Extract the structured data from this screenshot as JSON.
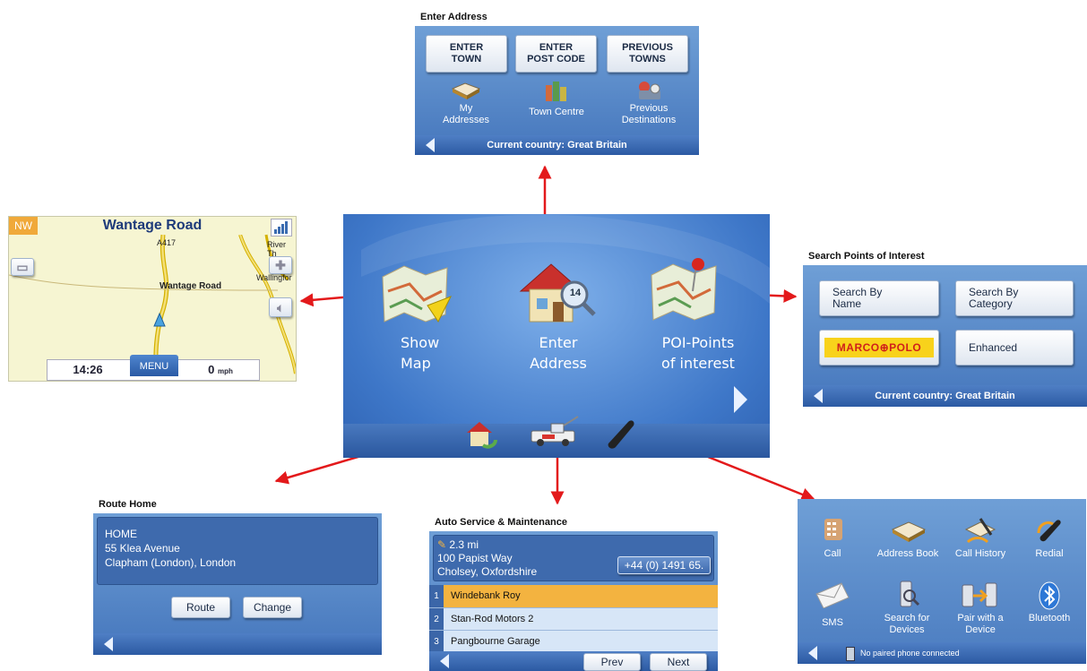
{
  "enter_address": {
    "title": "Enter Address",
    "buttons": [
      "ENTER\nTOWN",
      "ENTER\nPOST CODE",
      "PREVIOUS\nTOWNS"
    ],
    "icons": [
      {
        "label": "My\nAddresses",
        "icon": "address-book-icon"
      },
      {
        "label": "Town Centre",
        "icon": "town-centre-icon"
      },
      {
        "label": "Previous\nDestinations",
        "icon": "previous-destinations-icon"
      }
    ],
    "status": "Current country: Great Britain"
  },
  "map": {
    "heading": "NW",
    "street_title": "Wantage Road",
    "road_a417": "A417",
    "road_label": "Wantage Road",
    "river_label": "River Th",
    "town_label": "Wallingfor",
    "time": "14:26",
    "menu_label": "MENU",
    "speed_value": "0",
    "speed_unit": "mph"
  },
  "main_menu": {
    "items": [
      {
        "label": "Show\nMap",
        "icon": "map-icon"
      },
      {
        "label": "Enter\nAddress",
        "icon": "house-icon"
      },
      {
        "label": "POI-Points\nof interest",
        "icon": "poi-map-icon"
      }
    ],
    "address_number": "14",
    "bottom_icons": [
      "route-home-icon",
      "tow-truck-icon",
      "phone-icon"
    ]
  },
  "poi": {
    "title": "Search Points of Interest",
    "buttons": [
      "Search By\nName",
      "Search By\nCategory",
      "Enhanced"
    ],
    "logo_text": "MARCO⊕POLO",
    "status": "Current country: Great Britain"
  },
  "route_home": {
    "title": "Route Home",
    "address_lines": [
      "HOME",
      "55 Klea Avenue",
      "Clapham (London), London"
    ],
    "buttons": [
      "Route",
      "Change"
    ]
  },
  "auto_service": {
    "title": "Auto Service & Maintenance",
    "distance": "2.3 mi",
    "address_line1": "100 Papist Way",
    "address_line2": "Cholsey, Oxfordshire",
    "phone": "+44 (0) 1491 65.",
    "rows": [
      {
        "num": "1",
        "name": "Windebank Roy"
      },
      {
        "num": "2",
        "name": "Stan-Rod Motors 2"
      },
      {
        "num": "3",
        "name": "Pangbourne Garage"
      }
    ],
    "prev_label": "Prev",
    "next_label": "Next"
  },
  "phone": {
    "items": [
      {
        "label": "Call",
        "icon": "dialpad-icon"
      },
      {
        "label": "Address Book",
        "icon": "address-book-icon"
      },
      {
        "label": "Call History",
        "icon": "call-history-icon"
      },
      {
        "label": "Redial",
        "icon": "redial-icon"
      },
      {
        "label": "SMS",
        "icon": "envelope-icon"
      },
      {
        "label": "Search for\nDevices",
        "icon": "search-devices-icon"
      },
      {
        "label": "Pair with a\nDevice",
        "icon": "pair-device-icon"
      },
      {
        "label": "Bluetooth",
        "icon": "bluetooth-icon"
      }
    ],
    "status": "No paired phone connected"
  },
  "colors": {
    "arrow": "#e3191b",
    "panel_blue": "#5f90cf",
    "highlight": "#f3b340"
  }
}
